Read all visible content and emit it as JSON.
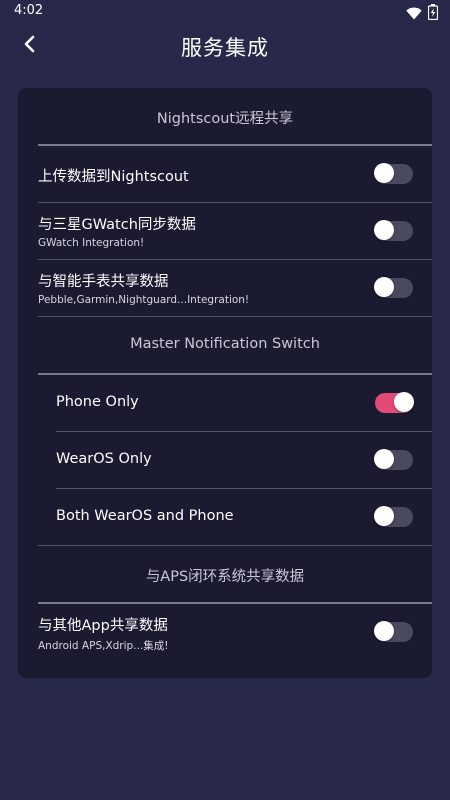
{
  "status_bar": {
    "time": "4:02",
    "icons": [
      "wifi-icon",
      "battery-charging-icon"
    ]
  },
  "header": {
    "back_icon": "chevron-left-icon",
    "title": "服务集成"
  },
  "colors": {
    "background": "#28284a",
    "card": "#1a1a30",
    "toggle_on": "#e24b78",
    "toggle_off": "#4a4a5e"
  },
  "sections": {
    "nightscout": {
      "title": "Nightscout远程共享",
      "items": [
        {
          "label": "上传数据到Nightscout",
          "sub": "",
          "enabled": false
        },
        {
          "label": "与三星GWatch同步数据",
          "sub": "GWatch Integration!",
          "enabled": false
        },
        {
          "label": "与智能手表共享数据",
          "sub": "Pebble,Garmin,Nightguard...Integration!",
          "enabled": false
        }
      ]
    },
    "notification": {
      "title": "Master Notification Switch",
      "items": [
        {
          "label": "Phone Only",
          "enabled": true
        },
        {
          "label": "WearOS Only",
          "enabled": false
        },
        {
          "label": "Both WearOS and Phone",
          "enabled": false
        }
      ]
    },
    "aps": {
      "title": "与APS闭环系统共享数据",
      "items": [
        {
          "label": "与其他App共享数据",
          "sub": "Android APS,Xdrip...集成!",
          "enabled": false
        }
      ]
    }
  }
}
